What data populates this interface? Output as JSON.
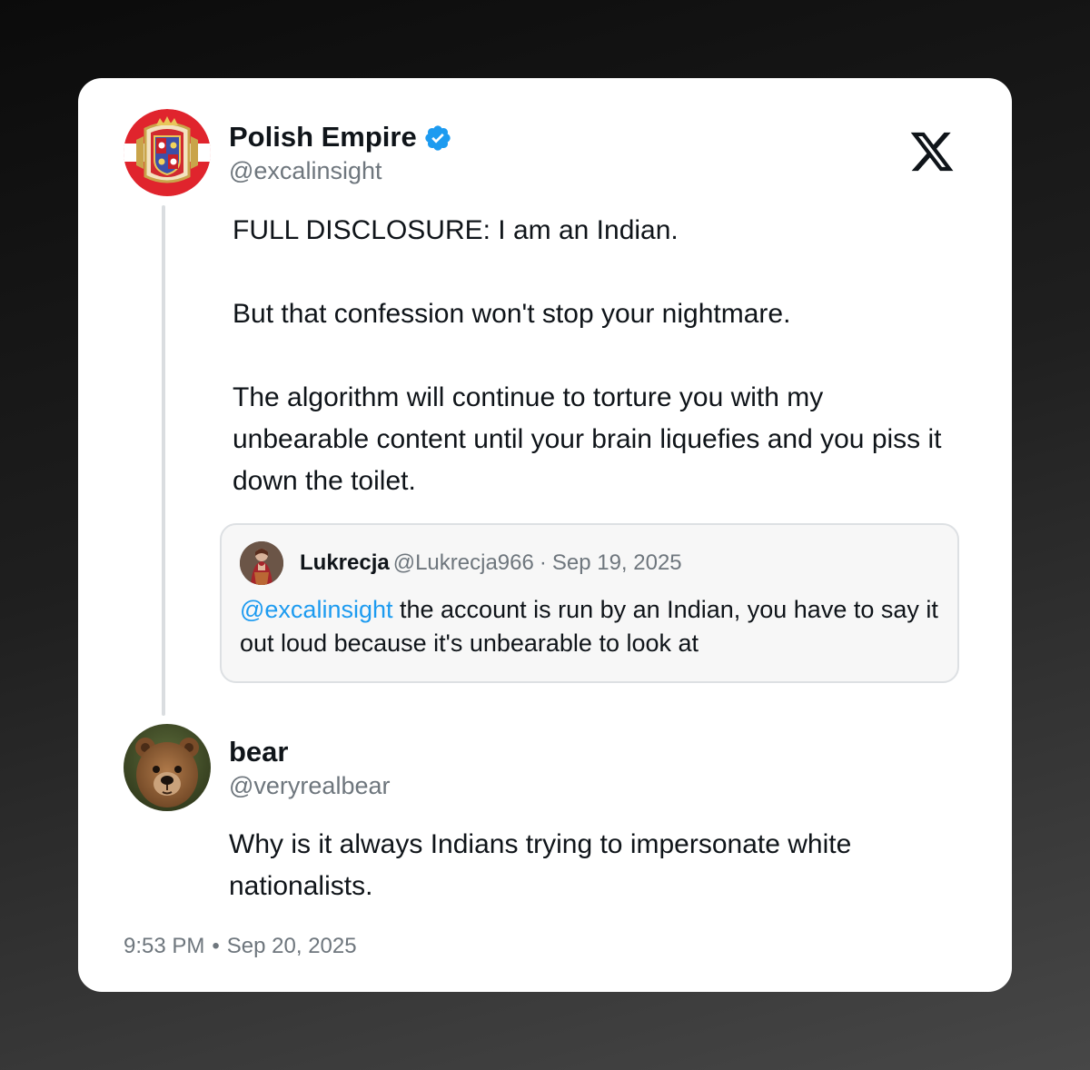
{
  "original_tweet": {
    "author": {
      "name": "Polish Empire",
      "handle": "@excalinsight",
      "verified": true,
      "avatar_icon": "coat-of-arms-avatar"
    },
    "text_paragraphs": [
      "FULL DISCLOSURE: I am an Indian.",
      "But that confession won't stop your nightmare.",
      "The algorithm will continue to torture you with my unbearable content until your brain liquefies and you piss it down the toilet."
    ],
    "quoted_tweet": {
      "author_name": "Lukrecja",
      "author_handle": "@Lukrecja966",
      "separator": "·",
      "date": "Sep 19, 2025",
      "mention": "@excalinsight",
      "text": " the account is run by an Indian, you have to say it out loud because it's unbearable to look at"
    }
  },
  "reply": {
    "author": {
      "name": "bear",
      "handle": "@veryrealbear",
      "avatar_icon": "bear-photo-avatar"
    },
    "text": "Why is it always Indians trying to impersonate white nationalists."
  },
  "timestamp": {
    "time": "9:53 PM",
    "separator": "•",
    "date": "Sep 20, 2025"
  },
  "branding": {
    "logo_icon": "x-logo-icon"
  },
  "colors": {
    "link": "#1d9bf0",
    "verified": "#1d9bf0",
    "secondary_text": "#6e767d",
    "primary_text": "#0f1419"
  }
}
